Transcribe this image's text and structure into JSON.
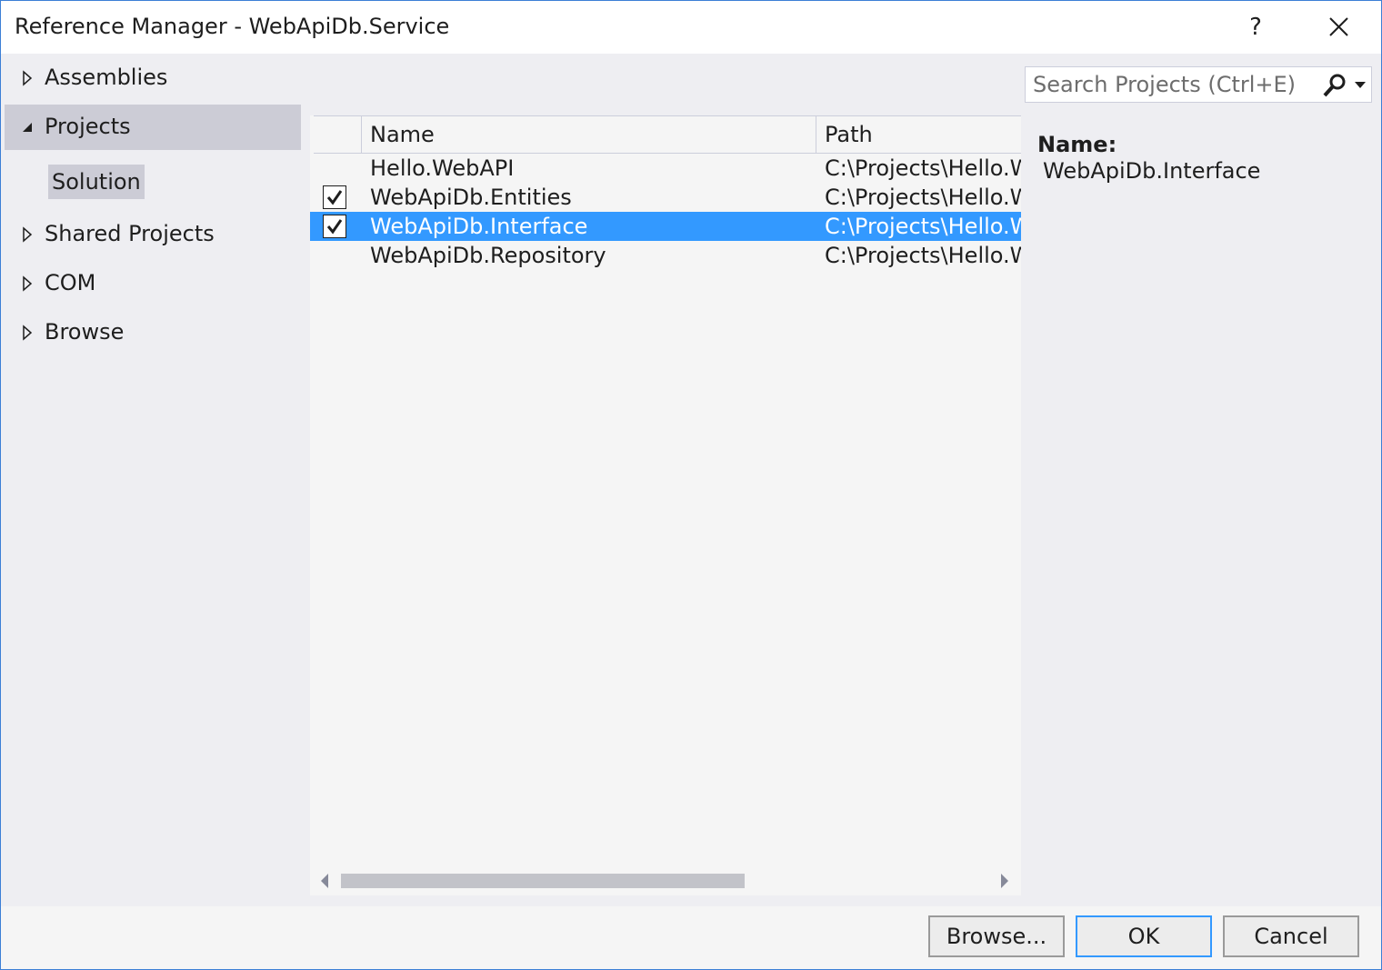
{
  "window": {
    "title": "Reference Manager - WebApiDb.Service",
    "help_label": "?"
  },
  "nav": {
    "items": [
      {
        "label": "Assemblies",
        "expanded": false,
        "selected": false
      },
      {
        "label": "Projects",
        "expanded": true,
        "selected": true
      },
      {
        "label": "Shared Projects",
        "expanded": false,
        "selected": false
      },
      {
        "label": "COM",
        "expanded": false,
        "selected": false
      },
      {
        "label": "Browse",
        "expanded": false,
        "selected": false
      }
    ],
    "sub_item": {
      "label": "Solution",
      "selected": true
    }
  },
  "search": {
    "placeholder": "Search Projects (Ctrl+E)",
    "value": ""
  },
  "list": {
    "columns": [
      "Name",
      "Path"
    ],
    "rows": [
      {
        "name": "Hello.WebAPI",
        "path": "C:\\Projects\\Hello.WebAPI",
        "checked": false,
        "selected": false
      },
      {
        "name": "WebApiDb.Entities",
        "path": "C:\\Projects\\Hello.WebAPI",
        "checked": true,
        "selected": false
      },
      {
        "name": "WebApiDb.Interface",
        "path": "C:\\Projects\\Hello.WebAPI",
        "checked": true,
        "selected": true
      },
      {
        "name": "WebApiDb.Repository",
        "path": "C:\\Projects\\Hello.WebAPI",
        "checked": false,
        "selected": false
      }
    ]
  },
  "details": {
    "name_label": "Name:",
    "name_value": "WebApiDb.Interface"
  },
  "footer": {
    "browse_label": "Browse...",
    "ok_label": "OK",
    "cancel_label": "Cancel"
  },
  "colors": {
    "accent": "#3399ff",
    "window_border": "#3c7fd6",
    "nav_selected": "#ccccd6",
    "panel_bg": "#eeeef2"
  }
}
